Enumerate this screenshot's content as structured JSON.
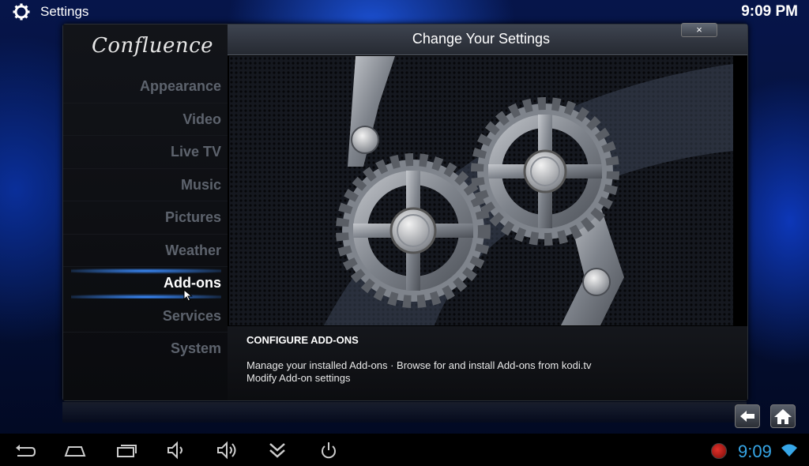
{
  "topbar": {
    "title": "Settings",
    "clock": "9:09 PM",
    "icon": "gear-icon"
  },
  "logo": "Confluence",
  "header": {
    "title": "Change Your Settings",
    "close_label": "×"
  },
  "menu": {
    "items": [
      {
        "label": "Appearance"
      },
      {
        "label": "Video"
      },
      {
        "label": "Live TV"
      },
      {
        "label": "Music"
      },
      {
        "label": "Pictures"
      },
      {
        "label": "Weather"
      },
      {
        "label": "Add-ons",
        "active": true
      },
      {
        "label": "Services"
      },
      {
        "label": "System"
      }
    ]
  },
  "description": {
    "title": "CONFIGURE ADD-ONS",
    "line1": "Manage your installed Add-ons · Browse for and install Add-ons from kodi.tv",
    "line2": "Modify Add-on settings"
  },
  "navbar": {
    "clock": "9:09"
  },
  "colors": {
    "accent": "#37a7e8",
    "selection_glow": "#3b8cff",
    "inactive_text": "#5d636d"
  }
}
